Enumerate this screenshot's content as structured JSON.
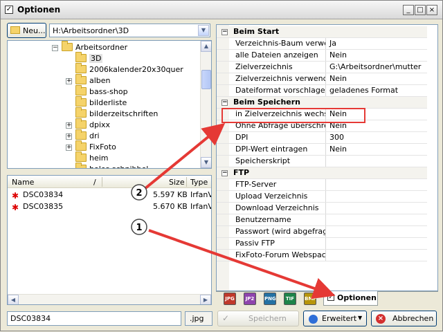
{
  "window": {
    "title": "Optionen"
  },
  "toolbar": {
    "new_label": "Neu...",
    "path": "H:\\Arbeitsordner\\3D"
  },
  "tree": {
    "items": [
      {
        "label": "Arbeitsordner",
        "expander": "−",
        "level": 0
      },
      {
        "label": "3D",
        "expander": "",
        "level": 1,
        "selected": true
      },
      {
        "label": "2006kalender20x30quer",
        "expander": "",
        "level": 1
      },
      {
        "label": "alben",
        "expander": "+",
        "level": 1
      },
      {
        "label": "bass-shop",
        "expander": "",
        "level": 1
      },
      {
        "label": "bilderliste",
        "expander": "",
        "level": 1
      },
      {
        "label": "bilderzeitschriften",
        "expander": "",
        "level": 1
      },
      {
        "label": "dpixx",
        "expander": "+",
        "level": 1
      },
      {
        "label": "dri",
        "expander": "+",
        "level": 1
      },
      {
        "label": "FixFoto",
        "expander": "+",
        "level": 1
      },
      {
        "label": "heim",
        "expander": "",
        "level": 1
      },
      {
        "label": "holes schnibbel",
        "expander": "",
        "level": 1
      }
    ]
  },
  "filelist": {
    "columns": [
      "Name",
      "/",
      "Size",
      "Type"
    ],
    "rows": [
      {
        "name": "DSC03834",
        "size": "5.597 KB",
        "type": "IrfanV"
      },
      {
        "name": "DSC03835",
        "size": "5.670 KB",
        "type": "IrfanV"
      }
    ]
  },
  "properties": {
    "groups": [
      {
        "title": "Beim Start",
        "rows": [
          {
            "name": "Verzeichnis-Baum verwe...",
            "value": "Ja"
          },
          {
            "name": "alle Dateien anzeigen",
            "value": "Nein"
          },
          {
            "name": "Zielverzeichnis",
            "value": "G:\\Arbeitsordner\\mutter"
          },
          {
            "name": "Zielverzeichnis verwenden",
            "value": "Nein"
          },
          {
            "name": "Dateiformat vorschlagen",
            "value": "geladenes Format"
          }
        ]
      },
      {
        "title": "Beim Speichern",
        "rows": [
          {
            "name": "in Zielverzeichnis wechs...",
            "value": "Nein"
          },
          {
            "name": "Ohne Abfrage überschrei...",
            "value": "Nein"
          },
          {
            "name": "DPI",
            "value": "300"
          },
          {
            "name": "DPI-Wert eintragen",
            "value": "Nein"
          },
          {
            "name": "Speicherskript",
            "value": ""
          }
        ]
      },
      {
        "title": "FTP",
        "rows": [
          {
            "name": "FTP-Server",
            "value": ""
          },
          {
            "name": "Upload Verzeichnis",
            "value": ""
          },
          {
            "name": "Download Verzeichnis",
            "value": ""
          },
          {
            "name": "Benutzername",
            "value": ""
          },
          {
            "name": "Passwort (wird abgefragt...",
            "value": ""
          },
          {
            "name": "Passiv FTP",
            "value": ""
          },
          {
            "name": "FixFoto-Forum Webspac...",
            "value": ""
          }
        ]
      }
    ]
  },
  "format_tabs": [
    {
      "label": "JPG",
      "color": "#c0392b"
    },
    {
      "label": "JP2",
      "color": "#8e44ad"
    },
    {
      "label": "PNG",
      "color": "#2471a3"
    },
    {
      "label": "TIF",
      "color": "#1e8449"
    },
    {
      "label": "BMP",
      "color": "#b7950b"
    }
  ],
  "options_tab": {
    "label": "Optionen"
  },
  "bottom": {
    "filename": "DSC03834",
    "extension": ".jpg",
    "save_label": "Speichern",
    "advanced_label": "Erweitert",
    "cancel_label": "Abbrechen"
  },
  "annotations": {
    "marker1": "1",
    "marker2": "2",
    "highlight_color": "#e53935"
  }
}
